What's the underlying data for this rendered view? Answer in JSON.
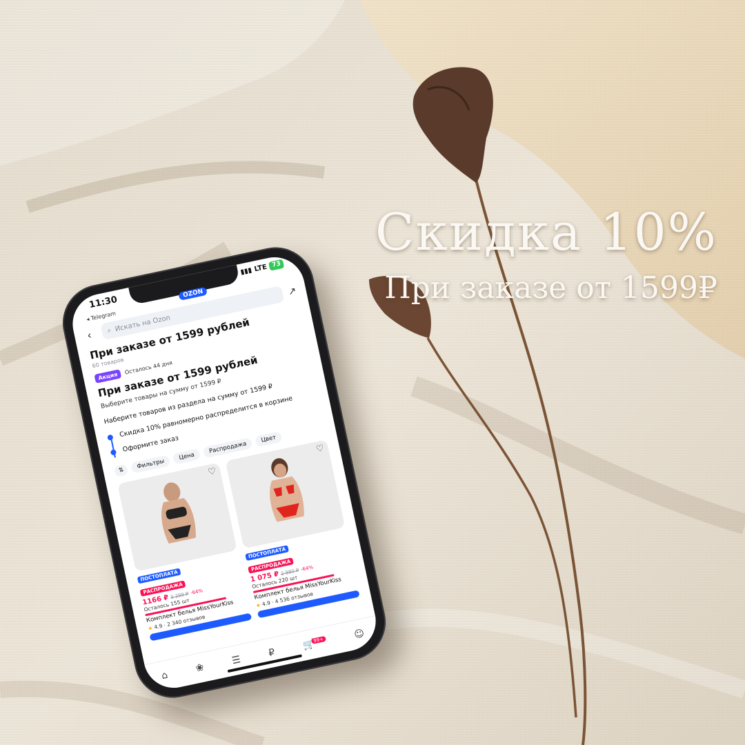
{
  "poster": {
    "title": "Скидка 10%",
    "subtitle": "При заказе от 1599₽",
    "colors": {
      "linen": "#e9e1d3",
      "sand": "#e6d3b3",
      "text": "#fbf8f3"
    }
  },
  "phone": {
    "status": {
      "time": "11:30",
      "network": "LTE",
      "battery": "73"
    },
    "back_app": "◂ Telegram",
    "brand": "OZON",
    "search_placeholder": "Искать на Ozon",
    "page_title": "При заказе от 1599 рублей",
    "items_count": "60 товаров",
    "promo_badge": "Акция",
    "days_left": "Осталось 44 дня",
    "promo_title": "При заказе от 1599 рублей",
    "promo_desc": "Выберите товары на сумму от 1599 ₽",
    "collect_note": "Наберите товаров из раздела на сумму от 1599 ₽",
    "steps": [
      "Скидка 10% равномерно распределится в корзине",
      "Оформите заказ"
    ],
    "chips": [
      "Фильтры",
      "Цена",
      "Распродажа",
      "Цвет"
    ],
    "products": [
      {
        "tag1": "ПОСТОПЛАТА",
        "tag2": "РАСПРОДАЖА",
        "price": "1166 ₽",
        "old_price": "3 299 ₽",
        "discount": "-64%",
        "stock": "Осталось 155 шт",
        "name": "Комплект белья MissYourKiss",
        "rating": "4.9",
        "reviews": "2 340 отзывов"
      },
      {
        "tag1": "ПОСТОПЛАТА",
        "tag2": "РАСПРОДАЖА",
        "price": "1 075 ₽",
        "old_price": "2 980 ₽",
        "discount": "-64%",
        "stock": "Осталось 220 шт",
        "name": "Комплект белья MissYourKiss",
        "rating": "4.9",
        "reviews": "4 536 отзывов"
      }
    ],
    "cart_count": "99+"
  }
}
